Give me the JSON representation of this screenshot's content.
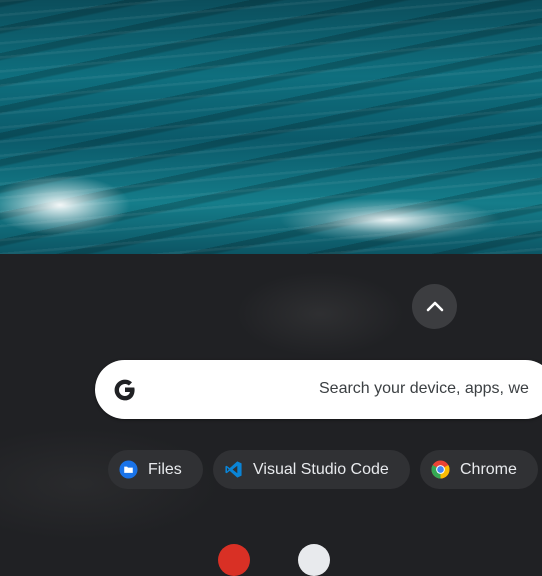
{
  "shelf": {
    "expand_button_icon": "chevron-up-icon",
    "search": {
      "logo_icon": "google-g-icon",
      "placeholder": "Search your device, apps, we"
    },
    "suggestions": [
      {
        "label": "Files",
        "icon": "files-icon",
        "color": "#1a73e8"
      },
      {
        "label": "Visual Studio Code",
        "icon": "vscode-icon",
        "color": "#0a84d6"
      },
      {
        "label": "Chrome",
        "icon": "chrome-icon",
        "color": "#34a853"
      }
    ]
  },
  "colors": {
    "shelf_bg": "#202124",
    "chip_bg": "#303134",
    "text": "#e8eaed"
  }
}
